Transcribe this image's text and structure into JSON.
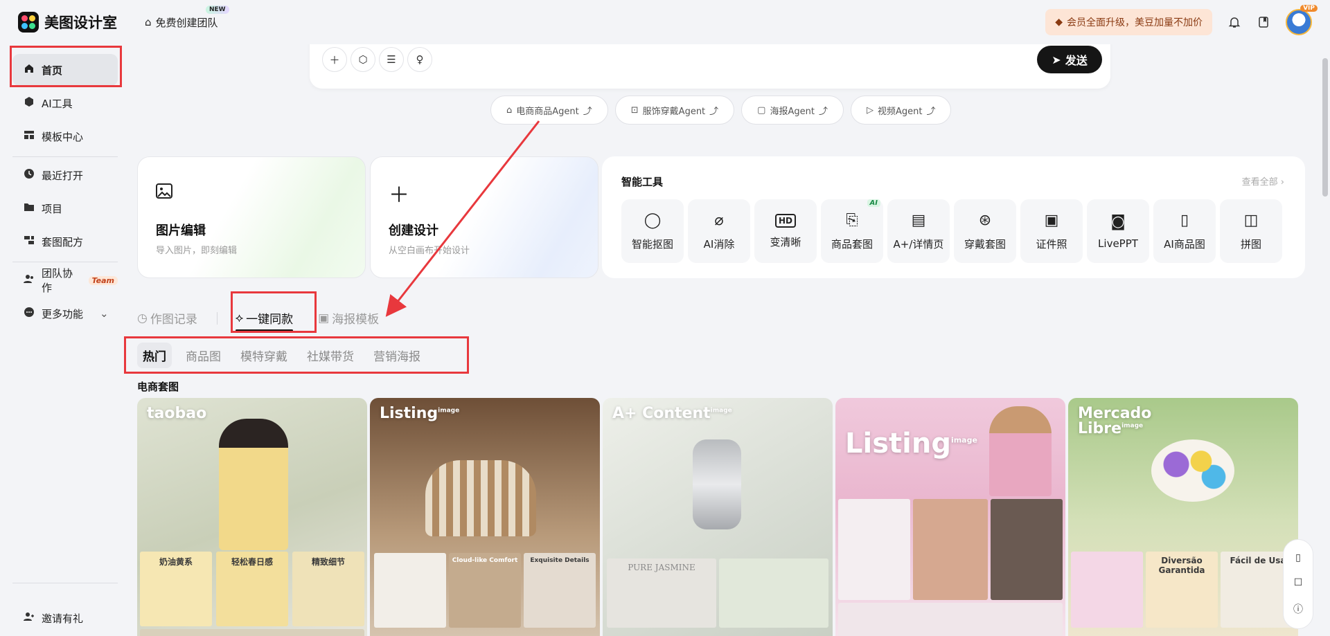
{
  "app": {
    "name": "美图设计室"
  },
  "topbar": {
    "team_label": "免费创建团队",
    "new_tag": "NEW",
    "upgrade_text": "会员全面升级，美豆加量不加价",
    "vip_tag": "VIP"
  },
  "sidebar": {
    "items": [
      {
        "label": "首页",
        "icon": "home-icon",
        "active": true
      },
      {
        "label": "AI工具",
        "icon": "cube-icon"
      },
      {
        "label": "模板中心",
        "icon": "grid-icon"
      },
      {
        "label": "最近打开",
        "icon": "clock-icon"
      },
      {
        "label": "项目",
        "icon": "folder-icon"
      },
      {
        "label": "套图配方",
        "icon": "stack-icon"
      },
      {
        "label": "团队协作",
        "icon": "users-icon",
        "badge": "Team"
      },
      {
        "label": "更多功能",
        "icon": "more-icon"
      }
    ],
    "invite_label": "邀请有礼"
  },
  "chat": {
    "send_label": "发送"
  },
  "agents": [
    "电商商品Agent",
    "服饰穿戴Agent",
    "海报Agent",
    "视频Agent"
  ],
  "cards": [
    {
      "title": "图片编辑",
      "subtitle": "导入图片，即刻编辑"
    },
    {
      "title": "创建设计",
      "subtitle": "从空白画布开始设计"
    }
  ],
  "tools": {
    "title": "智能工具",
    "view_all": "查看全部",
    "items": [
      {
        "label": "智能抠图",
        "icon": "cutout-icon"
      },
      {
        "label": "AI消除",
        "icon": "eraser-icon"
      },
      {
        "label": "变清晰",
        "icon": "hd-icon"
      },
      {
        "label": "商品套图",
        "icon": "product-icon",
        "tag": "AI"
      },
      {
        "label": "A+/详情页",
        "icon": "detail-page-icon"
      },
      {
        "label": "穿戴套图",
        "icon": "wear-icon"
      },
      {
        "label": "证件照",
        "icon": "id-photo-icon"
      },
      {
        "label": "LivePPT",
        "icon": "ppt-icon"
      },
      {
        "label": "AI商品图",
        "icon": "ai-product-icon"
      },
      {
        "label": "拼图",
        "icon": "collage-icon"
      }
    ]
  },
  "tabs": [
    "作图记录",
    "一键同款",
    "海报模板"
  ],
  "subtabs": [
    "热门",
    "商品图",
    "模特穿戴",
    "社媒带货",
    "营销海报"
  ],
  "section_title": "电商套图",
  "gallery": [
    {
      "brand": "taobao",
      "tiles": [
        "奶油黄系",
        "轻松春日感",
        "精致细节"
      ]
    },
    {
      "brand": "Listing",
      "tiles": [
        "Cloud-like Comfort",
        "Exquisite Details"
      ]
    },
    {
      "brand": "A+ Content",
      "tiles": [
        "PURE JASMINE"
      ]
    },
    {
      "brand": "Listing",
      "tiles": []
    },
    {
      "brand": "Mercado Libre",
      "tiles": [
        "Diversão Garantida",
        "Fácil de Usa"
      ]
    }
  ],
  "gallery_tag": "image",
  "colors": {
    "accent": "#151515",
    "highlight": "#e8383d",
    "upgrade_bg": "#fde5d6"
  }
}
